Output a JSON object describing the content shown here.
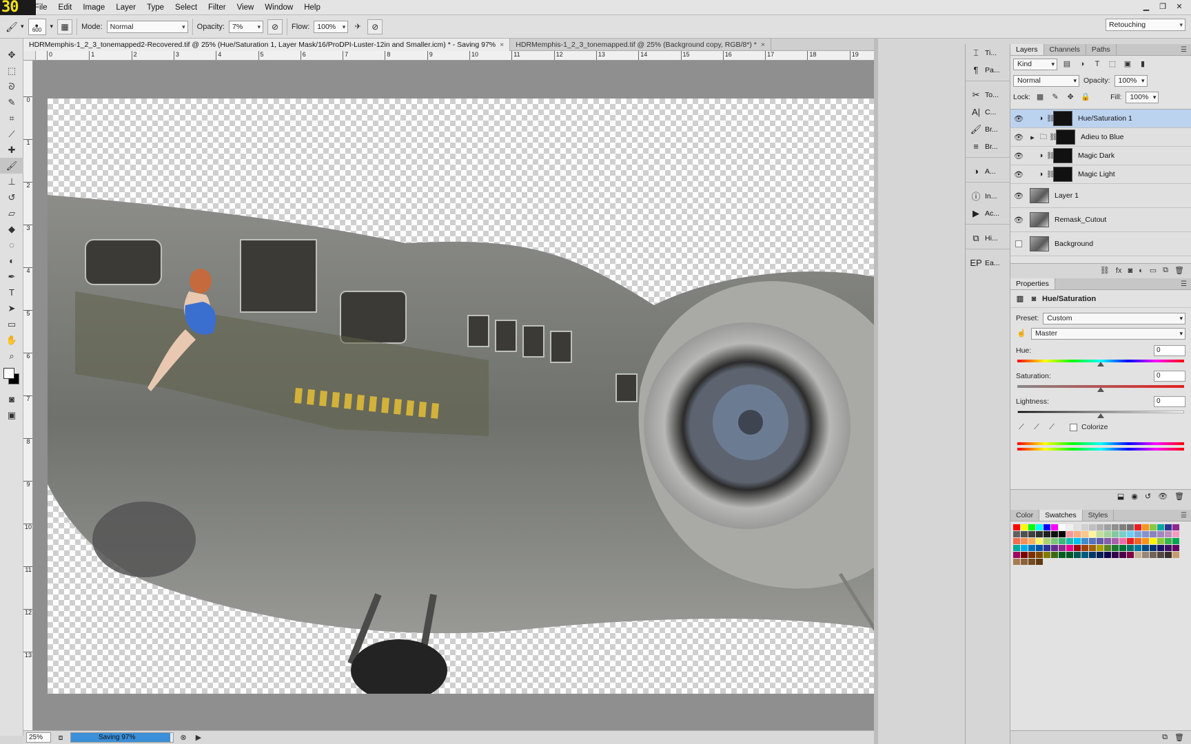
{
  "app": {
    "badge": "30"
  },
  "menu": [
    "File",
    "Edit",
    "Image",
    "Layer",
    "Type",
    "Select",
    "Filter",
    "View",
    "Window",
    "Help"
  ],
  "options": {
    "brush_size": "600",
    "mode_label": "Mode:",
    "mode_value": "Normal",
    "opacity_label": "Opacity:",
    "opacity_value": "7%",
    "flow_label": "Flow:",
    "flow_value": "100%",
    "workspace": "Retouching"
  },
  "tools": [
    {
      "name": "move-tool",
      "icon": "✥"
    },
    {
      "name": "marquee-tool",
      "icon": "⬚"
    },
    {
      "name": "lasso-tool",
      "icon": "ᘐ"
    },
    {
      "name": "quick-select-tool",
      "icon": "✎"
    },
    {
      "name": "crop-tool",
      "icon": "⌗"
    },
    {
      "name": "eyedropper-tool",
      "icon": "⟋"
    },
    {
      "name": "healing-brush-tool",
      "icon": "✚"
    },
    {
      "name": "brush-tool",
      "icon": "🖌"
    },
    {
      "name": "clone-stamp-tool",
      "icon": "⊥"
    },
    {
      "name": "history-brush-tool",
      "icon": "↺"
    },
    {
      "name": "eraser-tool",
      "icon": "▱"
    },
    {
      "name": "paint-bucket-tool",
      "icon": "◆"
    },
    {
      "name": "blur-tool",
      "icon": "◌"
    },
    {
      "name": "dodge-tool",
      "icon": "◐"
    },
    {
      "name": "pen-tool",
      "icon": "✒"
    },
    {
      "name": "type-tool",
      "icon": "T"
    },
    {
      "name": "path-select-tool",
      "icon": "➤"
    },
    {
      "name": "rectangle-tool",
      "icon": "▭"
    },
    {
      "name": "hand-tool",
      "icon": "✋"
    },
    {
      "name": "zoom-tool",
      "icon": "⌕"
    }
  ],
  "tabs": [
    {
      "label": "HDRMemphis-1_2_3_tonemapped2-Recovered.tif @ 25% (Hue/Saturation 1, Layer Mask/16/ProDPI-Luster-12in and Smaller.icm) * - Saving 97%",
      "close": "×"
    },
    {
      "label": "HDRMemphis-1_2_3_tonemapped.tif @ 25% (Background copy, RGB/8*) *",
      "close": "×"
    }
  ],
  "ruler_h": [
    "0",
    "1",
    "2",
    "3",
    "4",
    "5",
    "6",
    "7",
    "8",
    "9",
    "10",
    "11",
    "12",
    "13",
    "14",
    "15",
    "16",
    "17",
    "18",
    "19"
  ],
  "ruler_v": [
    "0",
    "1",
    "2",
    "3",
    "4",
    "5",
    "6",
    "7",
    "8",
    "9",
    "10",
    "11",
    "12",
    "13"
  ],
  "status": {
    "zoom": "25%",
    "progress_text": "Saving 97%",
    "progress": 0.97
  },
  "dock": [
    {
      "icon": "⌶",
      "label": "Ti..."
    },
    {
      "icon": "¶",
      "label": "Pa..."
    },
    {
      "icon": "✂",
      "label": "To..."
    },
    {
      "icon": "A|",
      "label": "C..."
    },
    {
      "icon": "🖌",
      "label": "Br..."
    },
    {
      "icon": "≡",
      "label": "Br..."
    },
    {
      "icon": "◑",
      "label": "A..."
    },
    {
      "icon": "ⓘ",
      "label": "In..."
    },
    {
      "icon": "▶",
      "label": "Ac..."
    },
    {
      "icon": "⧉",
      "label": "Hi..."
    },
    {
      "icon": "EP",
      "label": "Ea..."
    }
  ],
  "layers_panel": {
    "tabs": [
      "Layers",
      "Channels",
      "Paths"
    ],
    "kind": "Kind",
    "blend": "Normal",
    "opacity_label": "Opacity:",
    "opacity": "100%",
    "lock_label": "Lock:",
    "fill_label": "Fill:",
    "fill": "100%",
    "layers": [
      {
        "name": "Hue/Saturation 1",
        "type": "adjustment",
        "visible": true,
        "selected": true
      },
      {
        "name": "Adieu to Blue",
        "type": "group",
        "visible": true,
        "selected": false
      },
      {
        "name": "Magic Dark",
        "type": "adjustment",
        "visible": true,
        "selected": false
      },
      {
        "name": "Magic Light",
        "type": "adjustment",
        "visible": true,
        "selected": false
      },
      {
        "name": "Layer 1",
        "type": "pixel",
        "visible": true,
        "selected": false
      },
      {
        "name": "Remask_Cutout",
        "type": "pixel",
        "visible": true,
        "selected": false
      },
      {
        "name": "Background",
        "type": "pixel",
        "visible": false,
        "selected": false
      }
    ]
  },
  "properties": {
    "tab": "Properties",
    "title": "Hue/Saturation",
    "preset_label": "Preset:",
    "preset": "Custom",
    "channel": "Master",
    "hue_label": "Hue:",
    "hue": "0",
    "saturation_label": "Saturation:",
    "saturation": "0",
    "lightness_label": "Lightness:",
    "lightness": "0",
    "colorize_label": "Colorize"
  },
  "swatch_panel": {
    "tabs": [
      "Color",
      "Swatches",
      "Styles"
    ],
    "colors": [
      "#ff0000",
      "#ffff00",
      "#00ff00",
      "#00ffff",
      "#0000ff",
      "#ff00ff",
      "#ffffff",
      "#f0f0f0",
      "#e0e0e0",
      "#d0d0d0",
      "#c0c0c0",
      "#b0b0b0",
      "#a0a0a0",
      "#909090",
      "#808080",
      "#707070",
      "#ed1c24",
      "#f7941d",
      "#8dc63f",
      "#00a99d",
      "#2e3192",
      "#92278f",
      "#606060",
      "#505050",
      "#404040",
      "#303030",
      "#202020",
      "#101010",
      "#000000",
      "#f6989d",
      "#f9ad81",
      "#fdc68a",
      "#fff79a",
      "#c4df9b",
      "#a3d39c",
      "#82ca9d",
      "#7bcdc8",
      "#6ecff6",
      "#7ea7d8",
      "#8493ca",
      "#8882be",
      "#a187be",
      "#bc8dbf",
      "#f49ac2",
      "#f26c4f",
      "#f68e55",
      "#fbaf5c",
      "#fff467",
      "#acd372",
      "#7cc576",
      "#3bb878",
      "#1abbb4",
      "#00bff3",
      "#438ccb",
      "#5574b9",
      "#605ca8",
      "#855fa8",
      "#a763a8",
      "#f06eaa",
      "#ed1c24",
      "#f26522",
      "#f7941d",
      "#fff200",
      "#8dc73f",
      "#39b54a",
      "#00a651",
      "#00a99d",
      "#00aeef",
      "#0072bc",
      "#0054a6",
      "#2e3192",
      "#662d91",
      "#92278f",
      "#ec008c",
      "#9e0b0f",
      "#a0410d",
      "#a3620a",
      "#aba000",
      "#598527",
      "#1a7b30",
      "#007236",
      "#00746b",
      "#0076a3",
      "#004b80",
      "#003471",
      "#1b1464",
      "#440e62",
      "#630460",
      "#9e005d",
      "#790000",
      "#7b2e00",
      "#7d4900",
      "#827b00",
      "#406618",
      "#005e20",
      "#005826",
      "#005952",
      "#005b7f",
      "#003663",
      "#002157",
      "#0d004c",
      "#32004b",
      "#4b0049",
      "#7b0046",
      "#c7b299",
      "#998675",
      "#736357",
      "#534741",
      "#37302a",
      "#c69c6d",
      "#a67c52",
      "#8c6239",
      "#754c24",
      "#603913"
    ]
  }
}
